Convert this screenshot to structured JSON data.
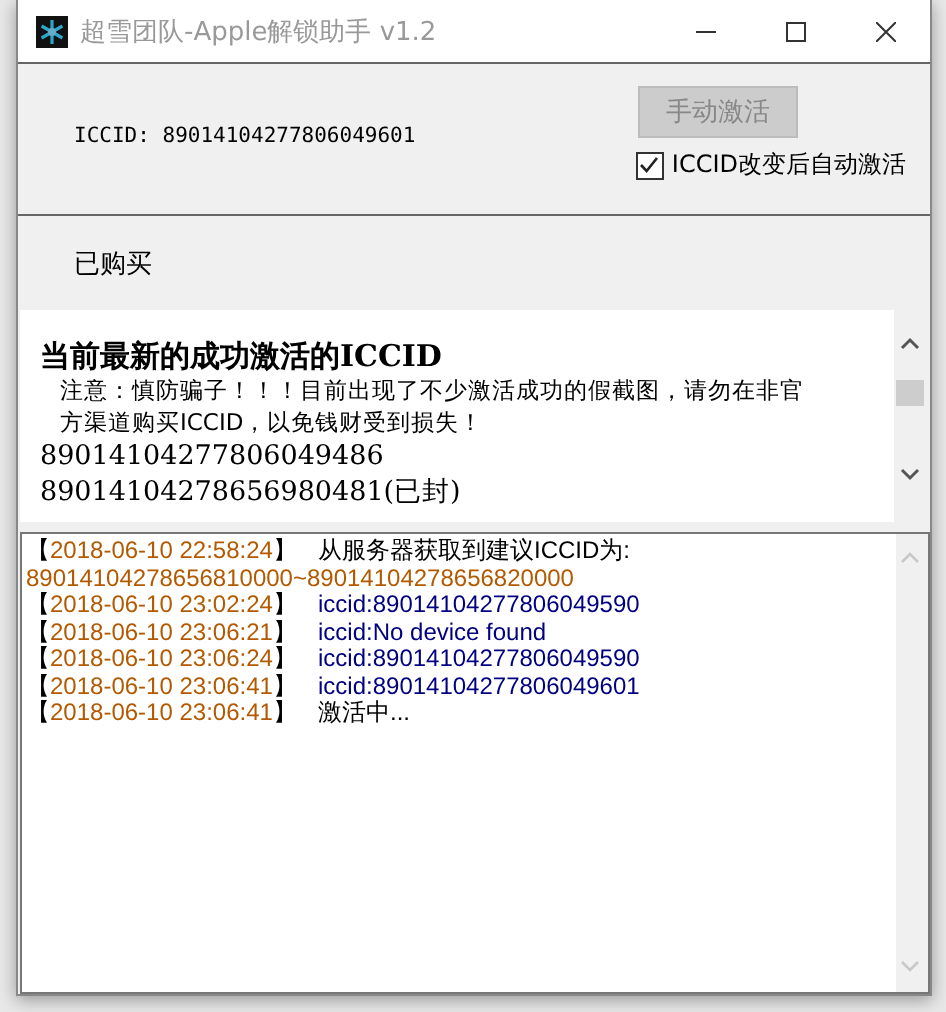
{
  "window": {
    "title": "超雪团队-Apple解锁助手 v1.2"
  },
  "top_panel": {
    "iccid_label": "ICCID: 89014104277806049601",
    "activate_button": {
      "label": "手动激活",
      "disabled": true
    },
    "auto_activate": {
      "label": "ICCID改变后自动激活",
      "checked": true
    }
  },
  "status_text": "已购买",
  "latest": {
    "heading": "当前最新的成功激活的ICCID",
    "notice": "注意：慎防骗子！！！目前出现了不少激活成功的假截图，请勿在非官方渠道购买ICCID，以免钱财受到损失！",
    "iccids": [
      "89014104277806049486",
      "89014104278656980481(已封)"
    ]
  },
  "log": [
    {
      "kind": "entry",
      "time": "【2018-06-10 22:58:24】",
      "message": "从服务器获取到建议ICCID为:",
      "color": "#000000"
    },
    {
      "kind": "wrap",
      "message": "89014104278656810000~89014104278656820000",
      "color": "#b35a00"
    },
    {
      "kind": "entry",
      "time": "【2018-06-10 23:02:24】",
      "message": "iccid:89014104277806049590",
      "color": "#000080"
    },
    {
      "kind": "entry",
      "time": "【2018-06-10 23:06:21】",
      "message": "iccid:No device found",
      "color": "#000080"
    },
    {
      "kind": "entry",
      "time": "【2018-06-10 23:06:24】",
      "message": "iccid:89014104277806049590",
      "color": "#000080"
    },
    {
      "kind": "entry",
      "time": "【2018-06-10 23:06:41】",
      "message": "iccid:89014104277806049601",
      "color": "#000080"
    },
    {
      "kind": "entry",
      "time": "【2018-06-10 23:06:41】",
      "message": "激活中...",
      "color": "#000000"
    }
  ]
}
